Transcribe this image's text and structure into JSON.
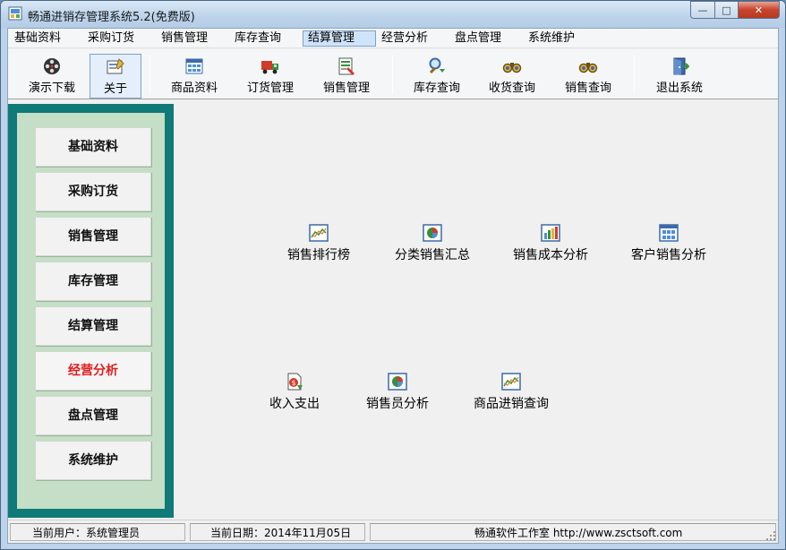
{
  "window": {
    "title": "畅通进销存管理系统5.2(免费版)",
    "controls": {
      "minimize": "—",
      "maximize": "□",
      "close": "✕"
    }
  },
  "menubar": {
    "items": [
      "基础资料",
      "采购订货",
      "销售管理",
      "库存查询",
      "结算管理",
      "经营分析",
      "盘点管理",
      "系统维护"
    ],
    "active_index": 4
  },
  "toolbar": {
    "buttons": [
      {
        "label": "演示下载",
        "icon": "film-reel-icon"
      },
      {
        "label": "关于",
        "icon": "about-icon"
      },
      {
        "label": "商品资料",
        "icon": "product-grid-icon"
      },
      {
        "label": "订货管理",
        "icon": "truck-icon"
      },
      {
        "label": "销售管理",
        "icon": "sales-form-icon"
      },
      {
        "label": "库存查询",
        "icon": "magnifier-icon"
      },
      {
        "label": "收货查询",
        "icon": "binoculars-icon"
      },
      {
        "label": "销售查询",
        "icon": "binoculars-icon"
      },
      {
        "label": "退出系统",
        "icon": "exit-door-icon"
      }
    ],
    "selected_index": 1
  },
  "sidebar": {
    "items": [
      "基础资料",
      "采购订货",
      "销售管理",
      "库存管理",
      "结算管理",
      "经营分析",
      "盘点管理",
      "系统维护"
    ],
    "active_index": 5,
    "active_color": "#e11c1c"
  },
  "main": {
    "features": [
      {
        "label": "销售排行榜",
        "icon": "line-chart-icon"
      },
      {
        "label": "分类销售汇总",
        "icon": "pie-chart-icon"
      },
      {
        "label": "销售成本分析",
        "icon": "bar-chart-icon"
      },
      {
        "label": "客户销售分析",
        "icon": "grid-table-icon"
      },
      {
        "label": "收入支出",
        "icon": "money-document-icon"
      },
      {
        "label": "销售员分析",
        "icon": "pie-chart-icon"
      },
      {
        "label": "商品进销查询",
        "icon": "line-chart-icon"
      }
    ]
  },
  "statusbar": {
    "user": "当前用户：系统管理员",
    "date": "当前日期：2014年11月05日",
    "company": "畅通软件工作室 http://www.zsctsoft.com"
  },
  "colors": {
    "sidebar_frame": "#0f7a78",
    "sidebar_fill": "#c4dfc5",
    "menu_highlight": "#cfe3fb",
    "close_button": "#c7442c"
  }
}
